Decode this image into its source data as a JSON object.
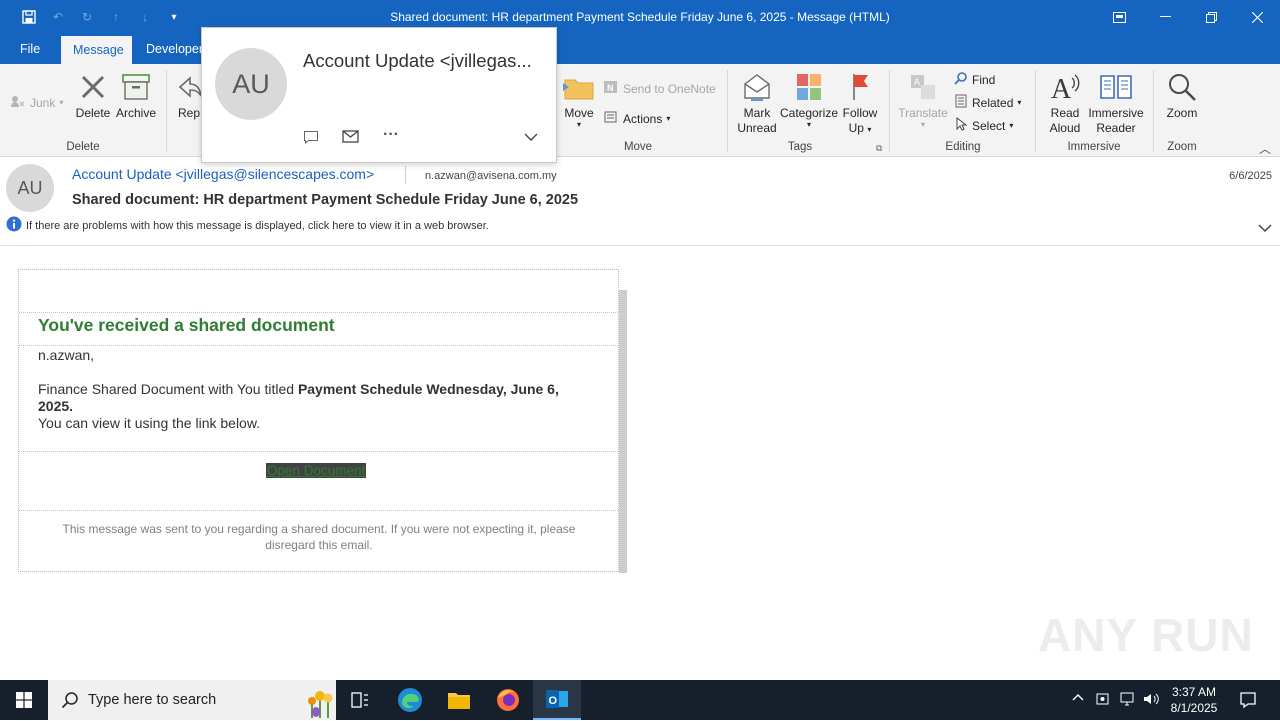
{
  "window": {
    "title": "Shared document: HR department Payment Schedule Friday June 6, 2025  -  Message (HTML)"
  },
  "tabs": [
    {
      "label": "File",
      "active": false
    },
    {
      "label": "Message",
      "active": true
    },
    {
      "label": "Developer",
      "active": false
    }
  ],
  "ribbon": {
    "delete_group": {
      "junk": "Junk",
      "delete": "Delete",
      "archive": "Archive",
      "label": "Delete"
    },
    "respond": {
      "reply_partial": "Rep"
    },
    "move_group": {
      "move": "Move",
      "send_onenote": "Send to OneNote",
      "actions": "Actions",
      "label": "Move"
    },
    "tags_group": {
      "mark_unread_1": "Mark",
      "mark_unread_2": "Unread",
      "categorize": "Categorize",
      "follow_up_1": "Follow",
      "follow_up_2": "Up",
      "label": "Tags"
    },
    "editing_group": {
      "translate": "Translate",
      "find": "Find",
      "related": "Related",
      "select": "Select",
      "label": "Editing"
    },
    "immersive_group": {
      "read_aloud_1": "Read",
      "read_aloud_2": "Aloud",
      "immersive_reader_1": "Immersive",
      "immersive_reader_2": "Reader",
      "label": "Immersive"
    },
    "zoom_group": {
      "zoom": "Zoom",
      "label": "Zoom"
    }
  },
  "contact_card": {
    "initials": "AU",
    "name": "Account Update <jvillegas..."
  },
  "message": {
    "initials": "AU",
    "from": "Account Update <jvillegas@silencescapes.com>",
    "to": "n.azwan@avisena.com.my",
    "date": "6/6/2025",
    "subject": "Shared document: HR department Payment Schedule Friday June 6, 2025",
    "info_bar": "If there are problems with how this message is displayed, click here to view it in a web browser."
  },
  "email_body": {
    "heading": "You've received a shared document",
    "greeting": "n.azwan,",
    "line1_prefix": "Finance Shared Document with You titled ",
    "line1_bold_a": "Payment Schedule Wednesday, June 6,",
    "line1_bold_b": "2025.",
    "line2": "You can view it using the link below.",
    "button": "Open Document",
    "footer": "This message was sent to you regarding a shared document. If you were not expecting it, please disregard this email."
  },
  "watermark": "ANY RUN",
  "taskbar": {
    "search_placeholder": "Type here to search",
    "time": "3:37 AM",
    "date": "8/1/2025"
  },
  "colors": {
    "title_bar": "#1565c0",
    "email_heading": "#2e7d32",
    "link": "#1b5fbf",
    "taskbar": "#16202c"
  }
}
